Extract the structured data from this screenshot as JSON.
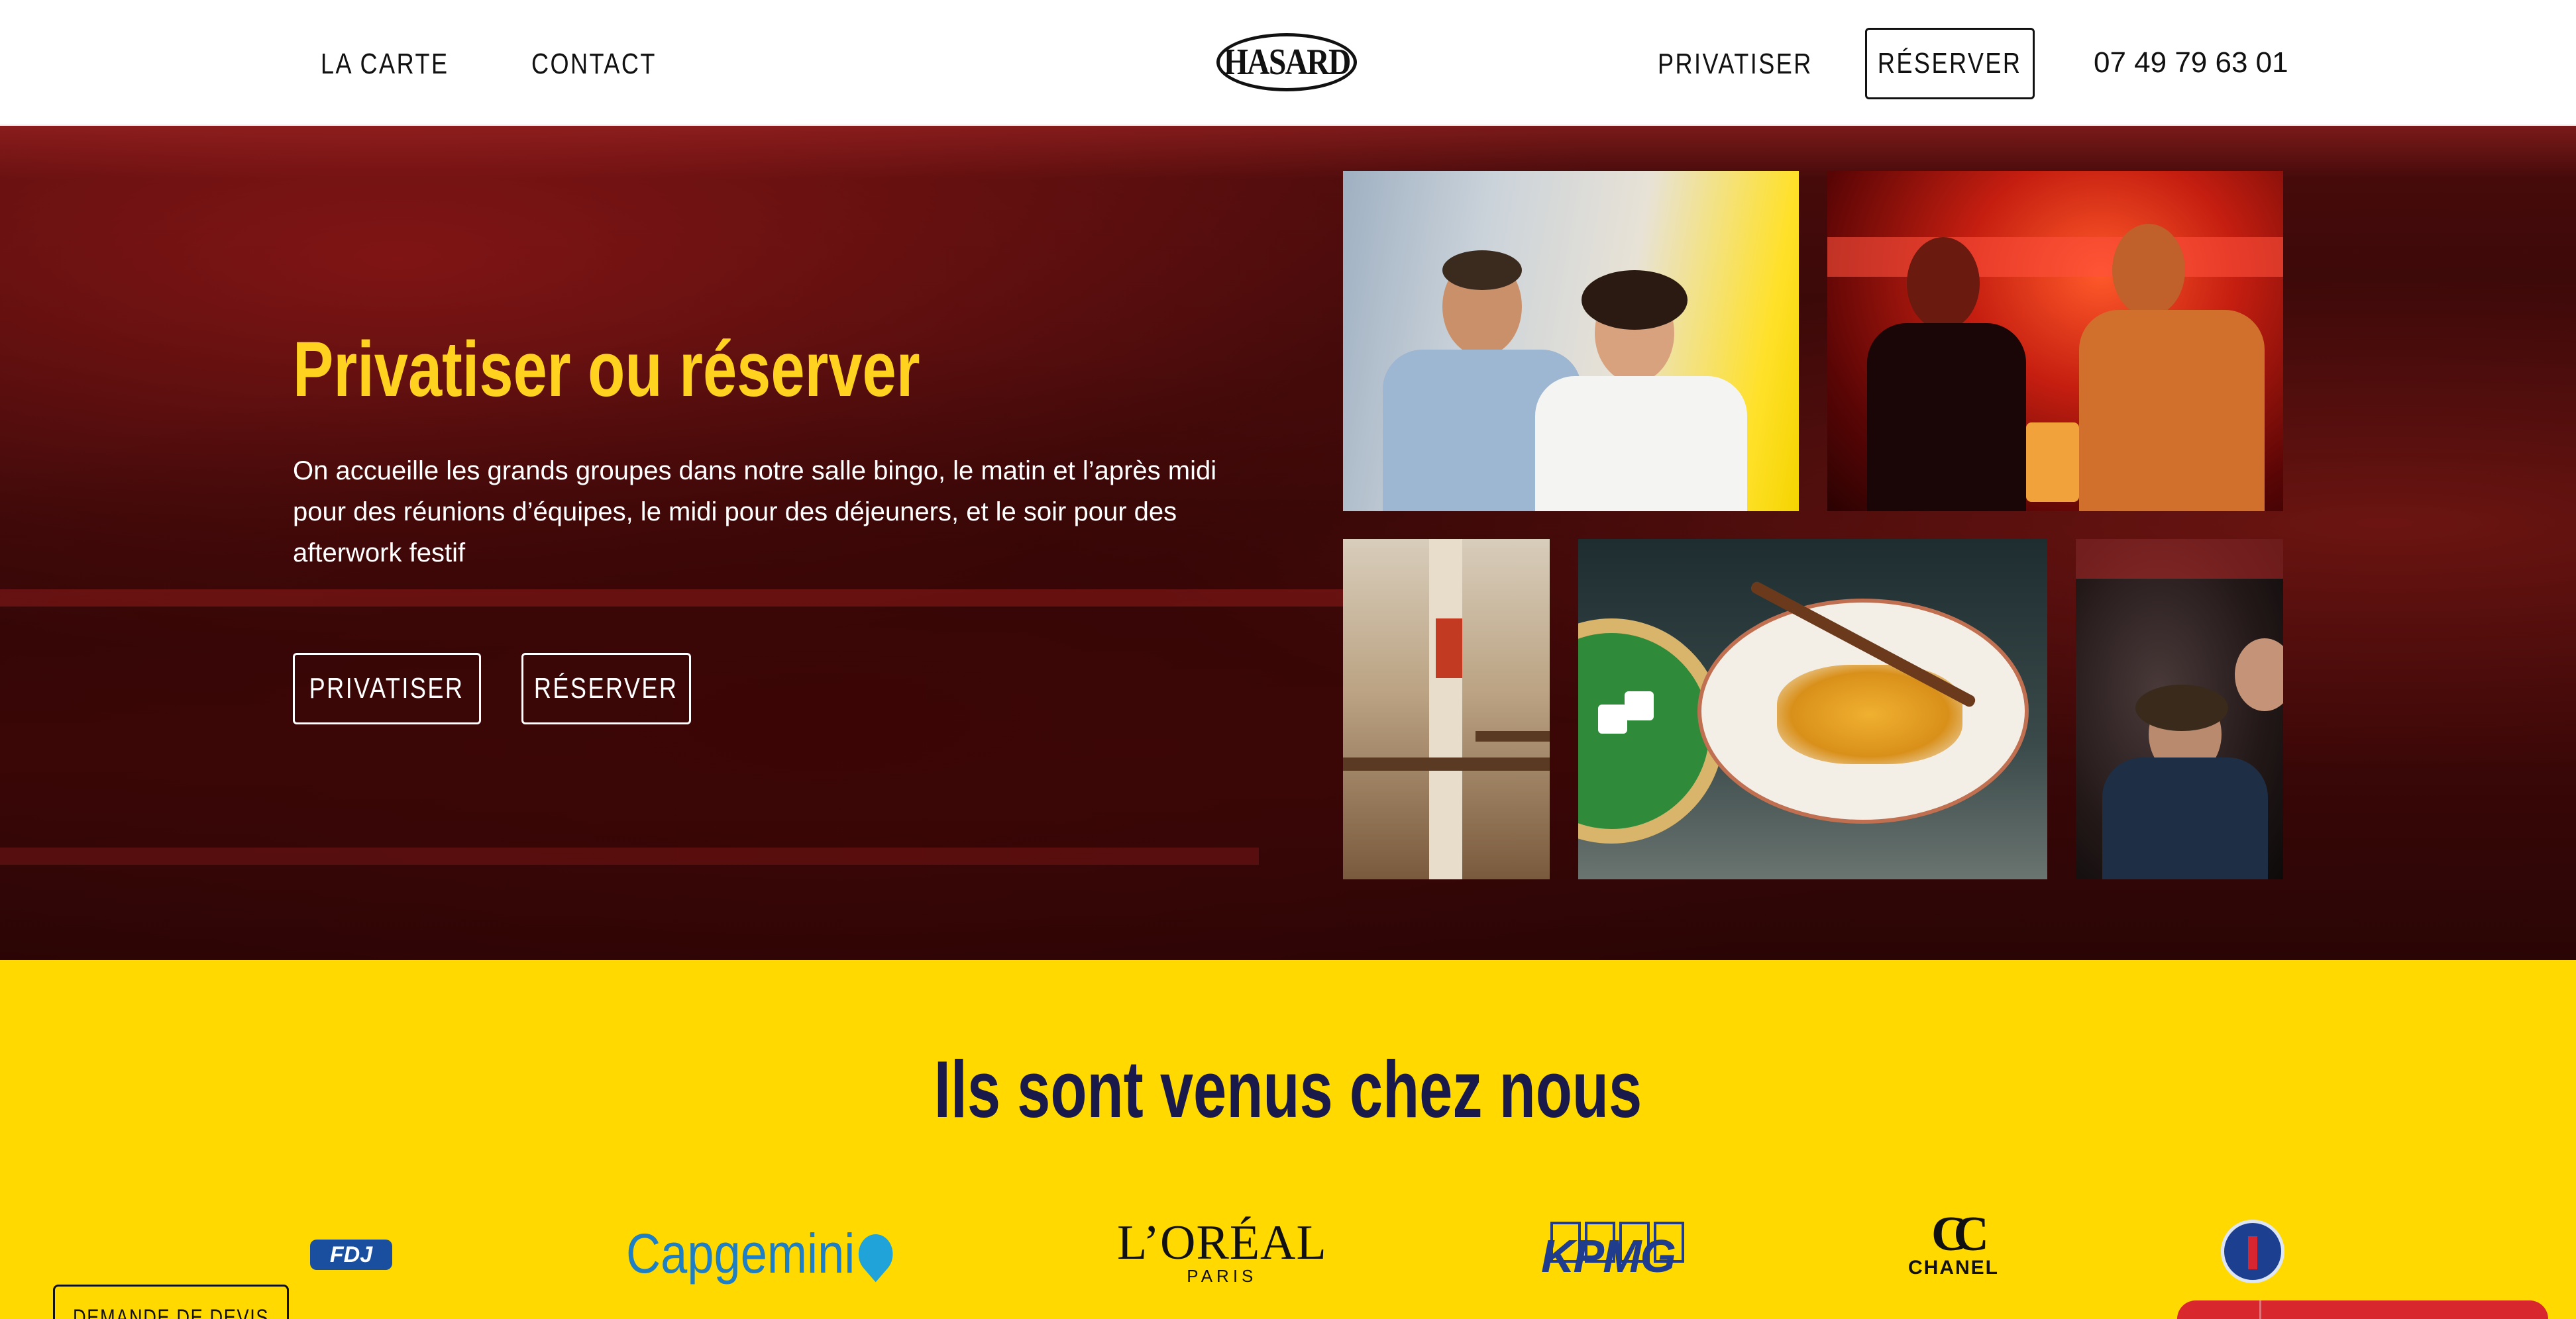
{
  "header": {
    "nav_left": [
      "LA CARTE",
      "CONTACT"
    ],
    "logo_text": "HASARD",
    "nav_privatiser": "PRIVATISER",
    "nav_reserver": "RÉSERVER",
    "phone": "07 49 79 63 01"
  },
  "hero": {
    "title": "Privatiser ou réserver",
    "text": "On accueille les grands groupes dans notre salle bingo, le matin et l’après midi pour des réunions d’équipes, le midi pour des déjeuners, et le soir pour des afterwork festif",
    "btn_privatiser": "PRIVATISER",
    "btn_reserver": "RÉSERVER",
    "title_color": "#ffd21f"
  },
  "clients": {
    "title": "Ils sont venus chez nous",
    "logos": {
      "fdj": "FDJ",
      "capgemini": "Capgemini",
      "loreal_main": "L’ORÉAL",
      "loreal_sub": "PARIS",
      "kpmg": "KPMG",
      "chanel_mark": "CC",
      "chanel_word": "CHANEL"
    },
    "background": "#ffd900"
  },
  "floating": {
    "devis": "DEMANDE DE DEVIS"
  }
}
